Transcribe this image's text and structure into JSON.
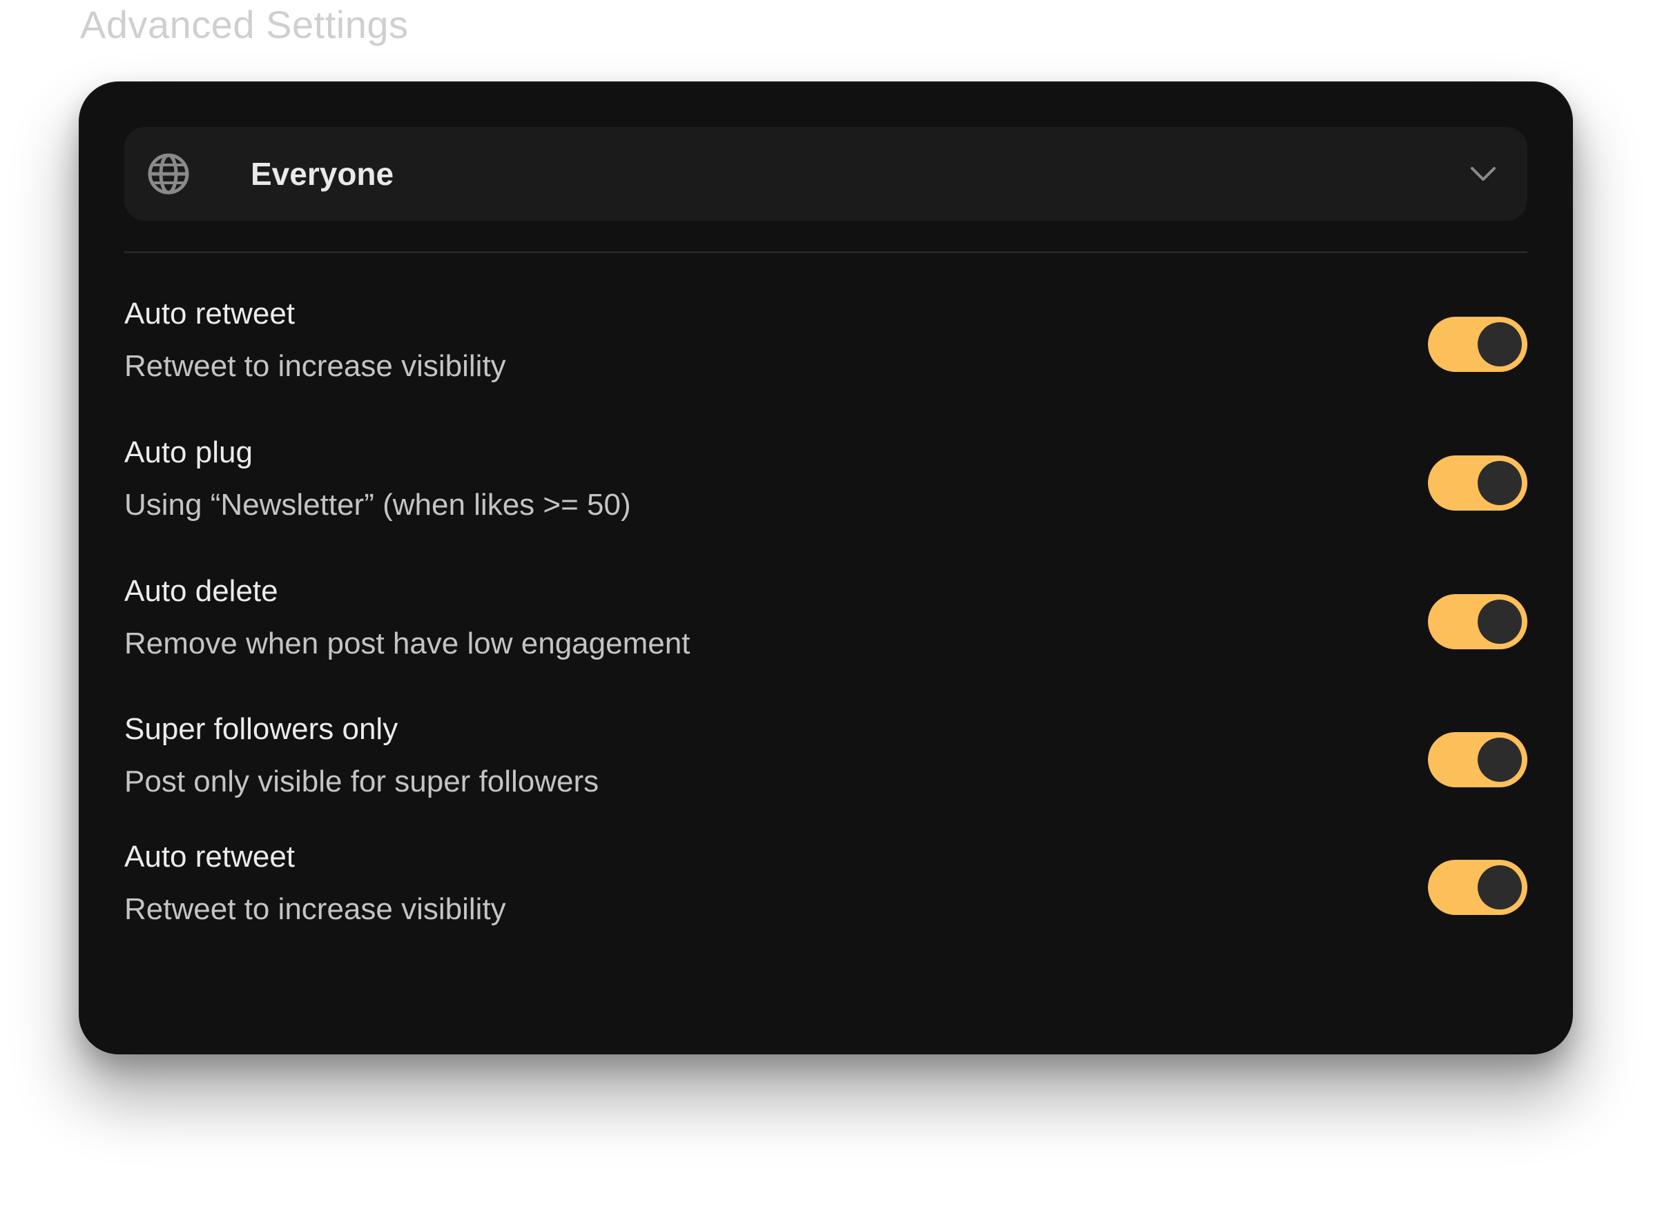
{
  "page": {
    "title": "Advanced Settings"
  },
  "audience_select": {
    "icon": "globe-icon",
    "selected": "Everyone",
    "chevron": "chevron-down-icon"
  },
  "settings": [
    {
      "title": "Auto retweet",
      "description": "Retweet to increase visibility",
      "enabled": true
    },
    {
      "title": "Auto plug",
      "description": "Using “Newsletter” (when likes >= 50)",
      "enabled": true
    },
    {
      "title": "Auto delete",
      "description": "Remove when post have low engagement",
      "enabled": true
    },
    {
      "title": "Super followers only",
      "description": "Post only visible for super followers",
      "enabled": true
    },
    {
      "title": "Auto retweet",
      "description": "Retweet to increase visibility",
      "enabled": true
    }
  ],
  "colors": {
    "card_background": "#111111",
    "dropdown_background": "#1b1b1b",
    "toggle_on": "#fdbf5a",
    "toggle_knob": "#2c2c2c",
    "title_text": "#cfcfcf"
  }
}
